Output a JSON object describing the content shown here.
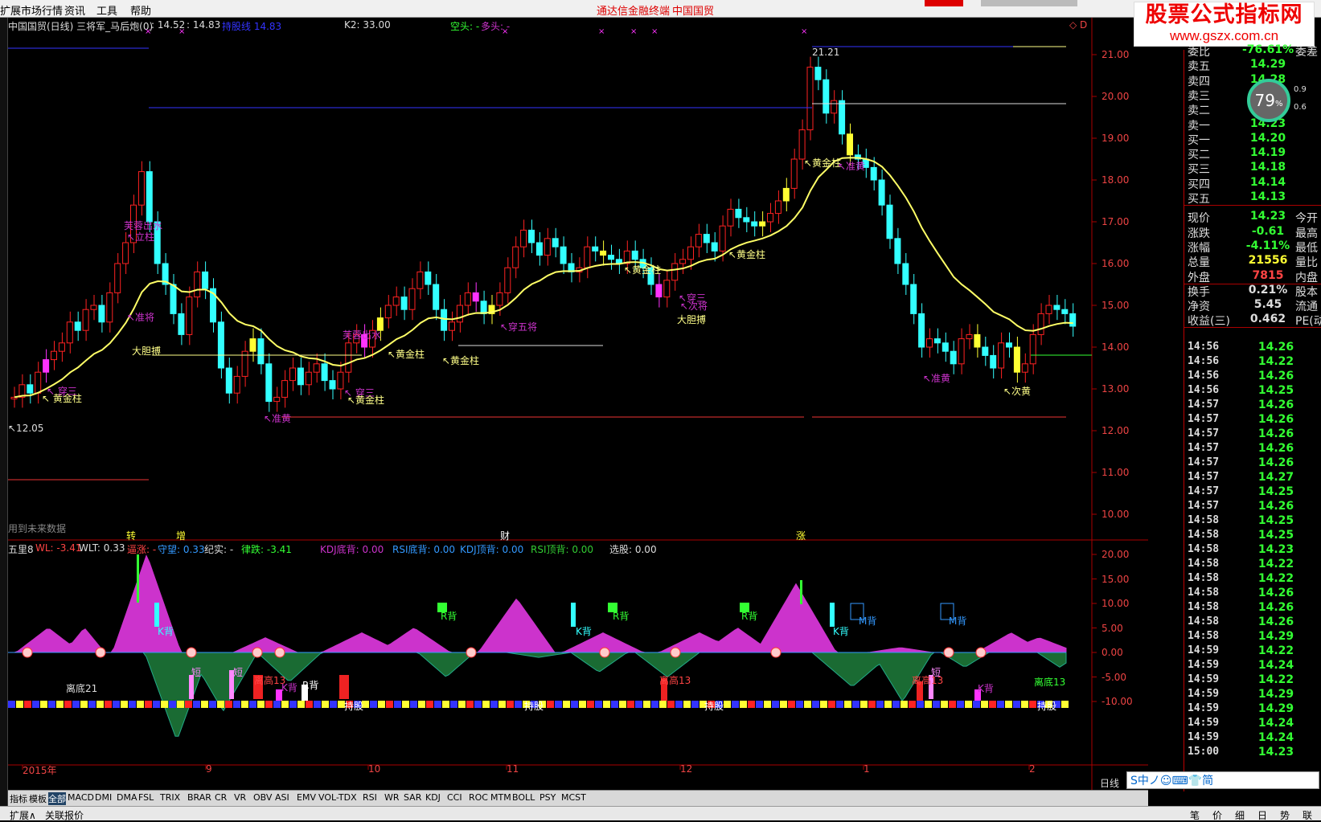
{
  "menu": [
    "扩展市场行情",
    "资讯",
    "工具",
    "帮助"
  ],
  "menu_right": [
    "通达信金融终端",
    "中国国贸"
  ],
  "watermark": {
    "line1": "股票公式指标网",
    "line2": "www.gszx.com.cn"
  },
  "chart_header": {
    "title": "中国国贸(日线) 三将军_马后炮(0)",
    "v1": ": 14.52",
    "v2": ": 14.83",
    "v3": "持股线 14.83",
    "k2": "K2: 33.00",
    "kt": "空头: -",
    "dt": "多头: -"
  },
  "right_header": "◇ D",
  "future_note": "用到未来数据",
  "events": [
    {
      "text": "转",
      "color": "#ff3"
    },
    {
      "text": "增",
      "color": "#ff3"
    },
    {
      "text": "财",
      "color": "#fff"
    },
    {
      "text": "涨",
      "color": "#ff3"
    }
  ],
  "price_axis": [
    "21.00",
    "20.00",
    "19.00",
    "18.00",
    "17.00",
    "16.00",
    "15.00",
    "14.00",
    "13.00",
    "12.00",
    "11.00",
    "10.00"
  ],
  "ind_axis": [
    "20.00",
    "15.00",
    "10.00",
    "5.00",
    "0.00",
    "-5.00",
    "-10.00"
  ],
  "date_axis": [
    "2015年",
    "9",
    "10",
    "11",
    "12",
    "1",
    "2"
  ],
  "period_label": "日线",
  "ind_header": [
    {
      "text": "五里8",
      "color": "#ddd"
    },
    {
      "text": "WL: -3.41",
      "color": "#f44"
    },
    {
      "text": "WLT: 0.33",
      "color": "#ddd"
    },
    {
      "text": "逼涨: -",
      "color": "#f44"
    },
    {
      "text": "守望: 0.33",
      "color": "#39f"
    },
    {
      "text": "纪实: -",
      "color": "#ddd"
    },
    {
      "text": "律跌: -3.41",
      "color": "#3f3"
    },
    {
      "text": "KDJ底背: 0.00",
      "color": "#c3c"
    },
    {
      "text": "RSI底背: 0.00",
      "color": "#39f"
    },
    {
      "text": "KDJ顶背: 0.00",
      "color": "#39f"
    },
    {
      "text": "RSI顶背: 0.00",
      "color": "#3c3"
    },
    {
      "text": "选股: 0.00",
      "color": "#ddd"
    }
  ],
  "chart_labels": [
    {
      "text": "↖ 黄金柱",
      "color": "#ff8"
    },
    {
      "text": "↖ 穿三",
      "color": "#c3c"
    },
    {
      "text": "↖12.05",
      "color": "#ddd"
    },
    {
      "text": "芙蓉出水",
      "color": "#c3c"
    },
    {
      "text": "↖立柱",
      "color": "#c3c"
    },
    {
      "text": "↖准将",
      "color": "#c3c"
    },
    {
      "text": "大胆搏",
      "color": "#ff8"
    },
    {
      "text": "↖准黄",
      "color": "#c3c"
    },
    {
      "text": "芙蓉出水",
      "color": "#c3c"
    },
    {
      "text": "↖ 穿三",
      "color": "#c3c"
    },
    {
      "text": "↖黄金柱",
      "color": "#ff8"
    },
    {
      "text": "↖黄金柱",
      "color": "#ff8"
    },
    {
      "text": "↖黄金柱",
      "color": "#ff8"
    },
    {
      "text": "↖穿五将",
      "color": "#c3c"
    },
    {
      "text": "↖黄金柱",
      "color": "#ff8"
    },
    {
      "text": "↖穿三",
      "color": "#c3c"
    },
    {
      "text": "↖次将",
      "color": "#c3c"
    },
    {
      "text": "大胆搏",
      "color": "#ff8"
    },
    {
      "text": "↖黄金柱",
      "color": "#ff8"
    },
    {
      "text": "↖黄金柱",
      "color": "#ff8"
    },
    {
      "text": "↖准黄",
      "color": "#c3c"
    },
    {
      "text": "21.21",
      "color": "#ddd"
    },
    {
      "text": "↖准黄",
      "color": "#c3c"
    },
    {
      "text": "↖次黄",
      "color": "#ff8"
    }
  ],
  "ind_labels": [
    {
      "text": "离底21",
      "color": "#ddd"
    },
    {
      "text": "K背",
      "color": "#3ff"
    },
    {
      "text": "短",
      "color": "#f8f"
    },
    {
      "text": "短",
      "color": "#f8f"
    },
    {
      "text": "离高13",
      "color": "#f44"
    },
    {
      "text": "K背",
      "color": "#c3c"
    },
    {
      "text": "R背",
      "color": "#fff"
    },
    {
      "text": "持股",
      "color": "#fff"
    },
    {
      "text": "R背",
      "color": "#3f3"
    },
    {
      "text": "K背",
      "color": "#3ff"
    },
    {
      "text": "R背",
      "color": "#3f3"
    },
    {
      "text": "持股",
      "color": "#fff"
    },
    {
      "text": "离高13",
      "color": "#f44"
    },
    {
      "text": "持股",
      "color": "#fff"
    },
    {
      "text": "R背",
      "color": "#3f3"
    },
    {
      "text": "K背",
      "color": "#3ff"
    },
    {
      "text": "M背",
      "color": "#39f"
    },
    {
      "text": "M背",
      "color": "#39f"
    },
    {
      "text": "离高13",
      "color": "#f44"
    },
    {
      "text": "短",
      "color": "#f8f"
    },
    {
      "text": "K背",
      "color": "#c3c"
    },
    {
      "text": "离底13",
      "color": "#3f3"
    },
    {
      "text": "持股",
      "color": "#fff"
    }
  ],
  "quote": [
    {
      "k": "委比",
      "v": "-76.61%",
      "c": "#3f3",
      "e": "委差"
    },
    {
      "k": "卖五",
      "v": "14.29",
      "c": "#3f3",
      "e": ""
    },
    {
      "k": "卖四",
      "v": "14.28",
      "c": "#3f3",
      "e": ""
    },
    {
      "k": "卖三",
      "v": "14.2",
      "c": "#3f3",
      "e": ""
    },
    {
      "k": "卖二",
      "v": "14.2",
      "c": "#3f3",
      "e": ""
    },
    {
      "k": "卖一",
      "v": "14.23",
      "c": "#3f3",
      "e": ""
    },
    {
      "k": "买一",
      "v": "14.20",
      "c": "#3f3",
      "e": ""
    },
    {
      "k": "买二",
      "v": "14.19",
      "c": "#3f3",
      "e": ""
    },
    {
      "k": "买三",
      "v": "14.18",
      "c": "#3f3",
      "e": ""
    },
    {
      "k": "买四",
      "v": "14.14",
      "c": "#3f3",
      "e": ""
    },
    {
      "k": "买五",
      "v": "14.13",
      "c": "#3f3",
      "e": ""
    },
    {
      "k": "现价",
      "v": "14.23",
      "c": "#3f3",
      "e": "今开"
    },
    {
      "k": "涨跌",
      "v": "-0.61",
      "c": "#3f3",
      "e": "最高"
    },
    {
      "k": "涨幅",
      "v": "-4.11%",
      "c": "#3f3",
      "e": "最低"
    },
    {
      "k": "总量",
      "v": "21556",
      "c": "#ff3",
      "e": "量比"
    },
    {
      "k": "外盘",
      "v": "7815",
      "c": "#f44",
      "e": "内盘"
    },
    {
      "k": "换手",
      "v": "0.21%",
      "c": "#ddd",
      "e": "股本"
    },
    {
      "k": "净资",
      "v": "5.45",
      "c": "#ddd",
      "e": "流通"
    },
    {
      "k": "收益(三)",
      "v": "0.462",
      "c": "#ddd",
      "e": "PE(动)"
    }
  ],
  "ticks": [
    [
      "14:56",
      "14.26"
    ],
    [
      "14:56",
      "14.22"
    ],
    [
      "14:56",
      "14.26"
    ],
    [
      "14:56",
      "14.25"
    ],
    [
      "14:57",
      "14.26"
    ],
    [
      "14:57",
      "14.26"
    ],
    [
      "14:57",
      "14.26"
    ],
    [
      "14:57",
      "14.26"
    ],
    [
      "14:57",
      "14.26"
    ],
    [
      "14:57",
      "14.27"
    ],
    [
      "14:57",
      "14.25"
    ],
    [
      "14:57",
      "14.26"
    ],
    [
      "14:58",
      "14.25"
    ],
    [
      "14:58",
      "14.25"
    ],
    [
      "14:58",
      "14.23"
    ],
    [
      "14:58",
      "14.22"
    ],
    [
      "14:58",
      "14.22"
    ],
    [
      "14:58",
      "14.26"
    ],
    [
      "14:58",
      "14.26"
    ],
    [
      "14:58",
      "14.26"
    ],
    [
      "14:58",
      "14.29"
    ],
    [
      "14:59",
      "14.22"
    ],
    [
      "14:59",
      "14.24"
    ],
    [
      "14:59",
      "14.22"
    ],
    [
      "14:59",
      "14.29"
    ],
    [
      "14:59",
      "14.29"
    ],
    [
      "14:59",
      "14.24"
    ],
    [
      "14:59",
      "14.24"
    ],
    [
      "15:00",
      "14.23"
    ]
  ],
  "ring": {
    "pct": "79",
    "unit": "%",
    "up": "0.9",
    "dn": "0.6"
  },
  "tabs": [
    "指标",
    "模板",
    "全部",
    "MACD",
    "DMI",
    "DMA",
    "FSL",
    "TRIX",
    "BRAR",
    "CR",
    "VR",
    "OBV",
    "ASI",
    "EMV",
    "VOL-TDX",
    "RSI",
    "WR",
    "SAR",
    "KDJ",
    "CCI",
    "ROC",
    "MTM",
    "BOLL",
    "PSY",
    "MCST"
  ],
  "bottom_left": [
    "扩展∧",
    "关联报价"
  ],
  "bottom_right": [
    "笔",
    "价",
    "细",
    "日",
    "势",
    "联"
  ],
  "ime": "S中ノ☺⌨👕简"
}
